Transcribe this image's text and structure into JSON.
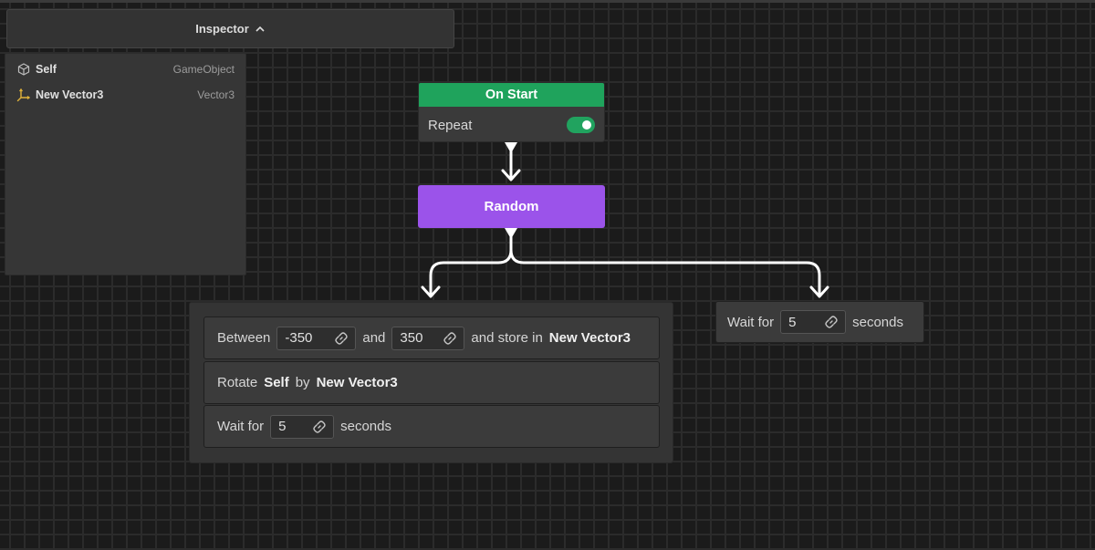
{
  "inspector": {
    "title": "Inspector",
    "toggle_icon": "chevron-up-icon",
    "items": [
      {
        "name": "Self",
        "type": "GameObject",
        "icon": "cube-icon"
      },
      {
        "name": "New Vector3",
        "type": "Vector3",
        "icon": "axis-icon"
      }
    ]
  },
  "nodes": {
    "on_start": {
      "title": "On Start",
      "row_label": "Repeat",
      "repeat_enabled": true,
      "color": "#1fa35c"
    },
    "random": {
      "title": "Random",
      "color": "#9b53ea"
    },
    "group": {
      "between": {
        "word1": "Between",
        "min": "-350",
        "word2": "and",
        "max": "350",
        "word3": "and store in",
        "target": "New Vector3"
      },
      "rotate": {
        "word1": "Rotate",
        "object": "Self",
        "word2": "by",
        "value": "New Vector3"
      },
      "wait": {
        "word1": "Wait for",
        "value": "5",
        "word2": "seconds"
      }
    },
    "wait_right": {
      "word1": "Wait for",
      "value": "5",
      "word2": "seconds"
    }
  },
  "colors": {
    "accent_green": "#1fa35c",
    "accent_purple": "#9b53ea",
    "toggle_on": "#21a35f"
  }
}
